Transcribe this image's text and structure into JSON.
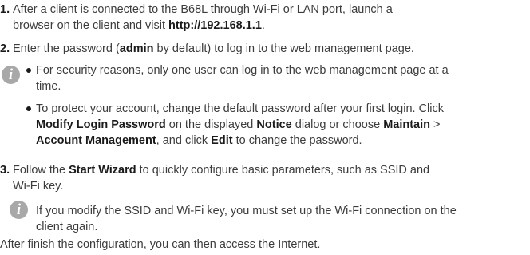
{
  "steps": [
    {
      "number": "1.",
      "lines": [
        [
          "After a client is connected to the B68L through Wi-Fi or LAN port, launch a"
        ],
        [
          "browser on the client and visit ",
          {
            "b": "http://192.168.1.1"
          },
          "."
        ]
      ]
    },
    {
      "number": "2.",
      "lines": [
        [
          "Enter the password (",
          {
            "b": "admin"
          },
          " by default) to log in to the web management page."
        ]
      ]
    },
    {
      "number": "3.",
      "lines": [
        [
          "Follow the ",
          {
            "b": "Start Wizard"
          },
          " to quickly configure basic parameters, such as SSID and"
        ],
        [
          "Wi-Fi key."
        ]
      ]
    }
  ],
  "note1": {
    "icon": "info-icon",
    "bullets": [
      [
        [
          "For security reasons, only one user can log in to the web management page at a"
        ],
        [
          "time."
        ]
      ],
      [
        [
          "To protect your account, change the default password after your first login. Click"
        ],
        [
          {
            "b": "Modify Login Password"
          },
          " on the displayed ",
          {
            "b": "Notice"
          },
          " dialog or choose ",
          {
            "b": "Maintain"
          },
          " >"
        ],
        [
          {
            "b": "Account Management"
          },
          ", and click ",
          {
            "b": "Edit"
          },
          " to change the password."
        ]
      ]
    ]
  },
  "note2": {
    "icon": "info-icon",
    "lines": [
      [
        "If you modify the SSID and Wi-Fi key, you must set up the Wi-Fi connection on the"
      ],
      [
        "client again."
      ]
    ]
  },
  "closing": "After finish the configuration, you can then access the Internet."
}
